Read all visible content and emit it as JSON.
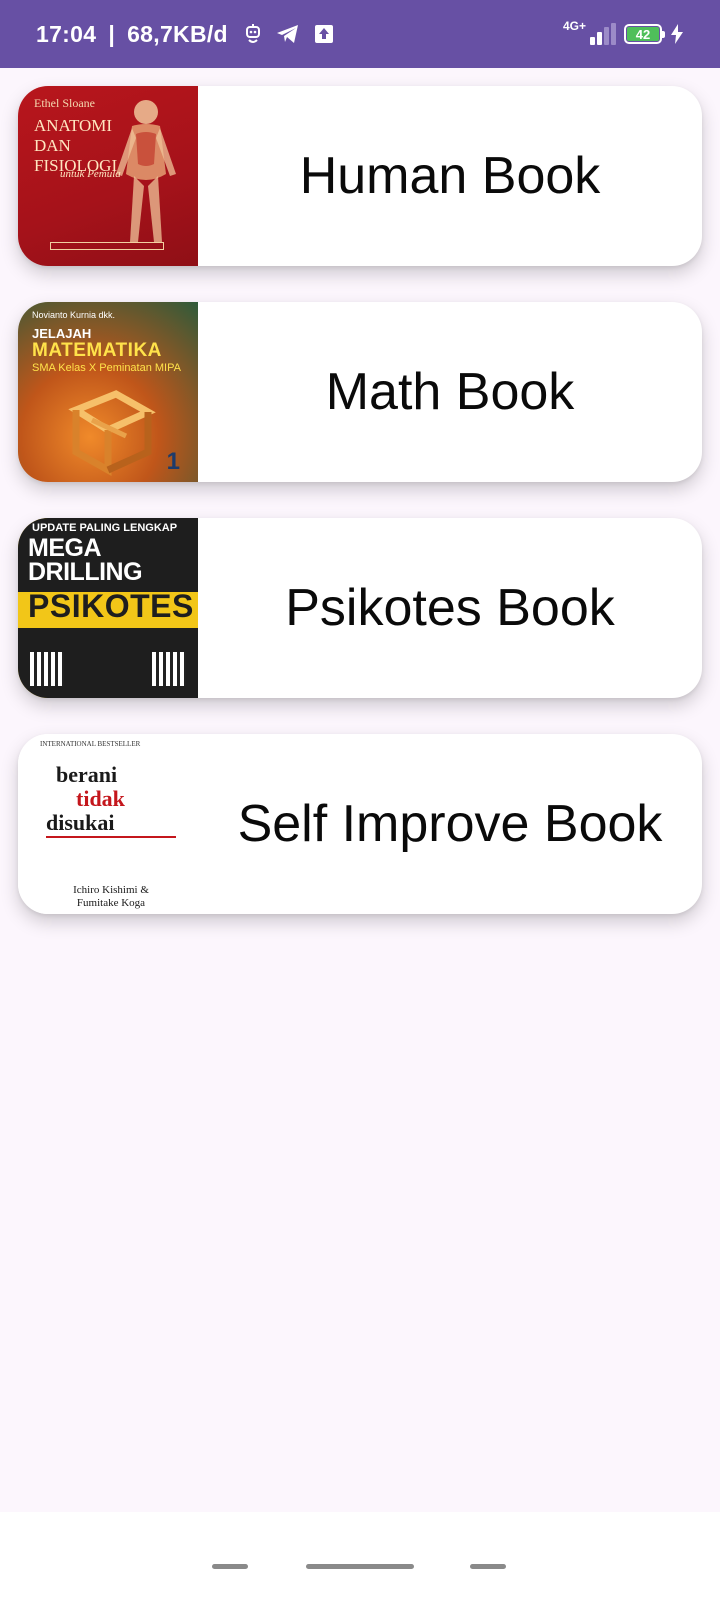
{
  "status_bar": {
    "time": "17:04",
    "speed": "68,7KB/d",
    "network": "4G+",
    "battery": "42"
  },
  "books": [
    {
      "title": "Human Book",
      "cover": {
        "author": "Ethel Sloane",
        "line1": "ANATOMI DAN FISIOLOGI",
        "line2": "untuk Pemula"
      }
    },
    {
      "title": "Math Book",
      "cover": {
        "author": "Novianto Kurnia dkk.",
        "line1": "JELAJAH",
        "line2": "MATEMATIKA",
        "line3": "SMA Kelas X Peminatan MIPA",
        "number": "1"
      }
    },
    {
      "title": "Psikotes Book",
      "cover": {
        "line0": "UPDATE PALING LENGKAP",
        "line1": "MEGA DRILLING",
        "line2": "PSIKOTES"
      }
    },
    {
      "title": "Self Improve Book",
      "cover": {
        "line0": "INTERNATIONAL BESTSELLER",
        "line1": "berani",
        "line2": "tidak",
        "line3": "disukai",
        "authors": "Ichiro Kishimi & Fumitake Koga"
      }
    }
  ],
  "colors": {
    "status_bar": "#6750a4",
    "background": "#fcf6fd",
    "card": "#ffffff",
    "battery": "#4fbf5a"
  }
}
